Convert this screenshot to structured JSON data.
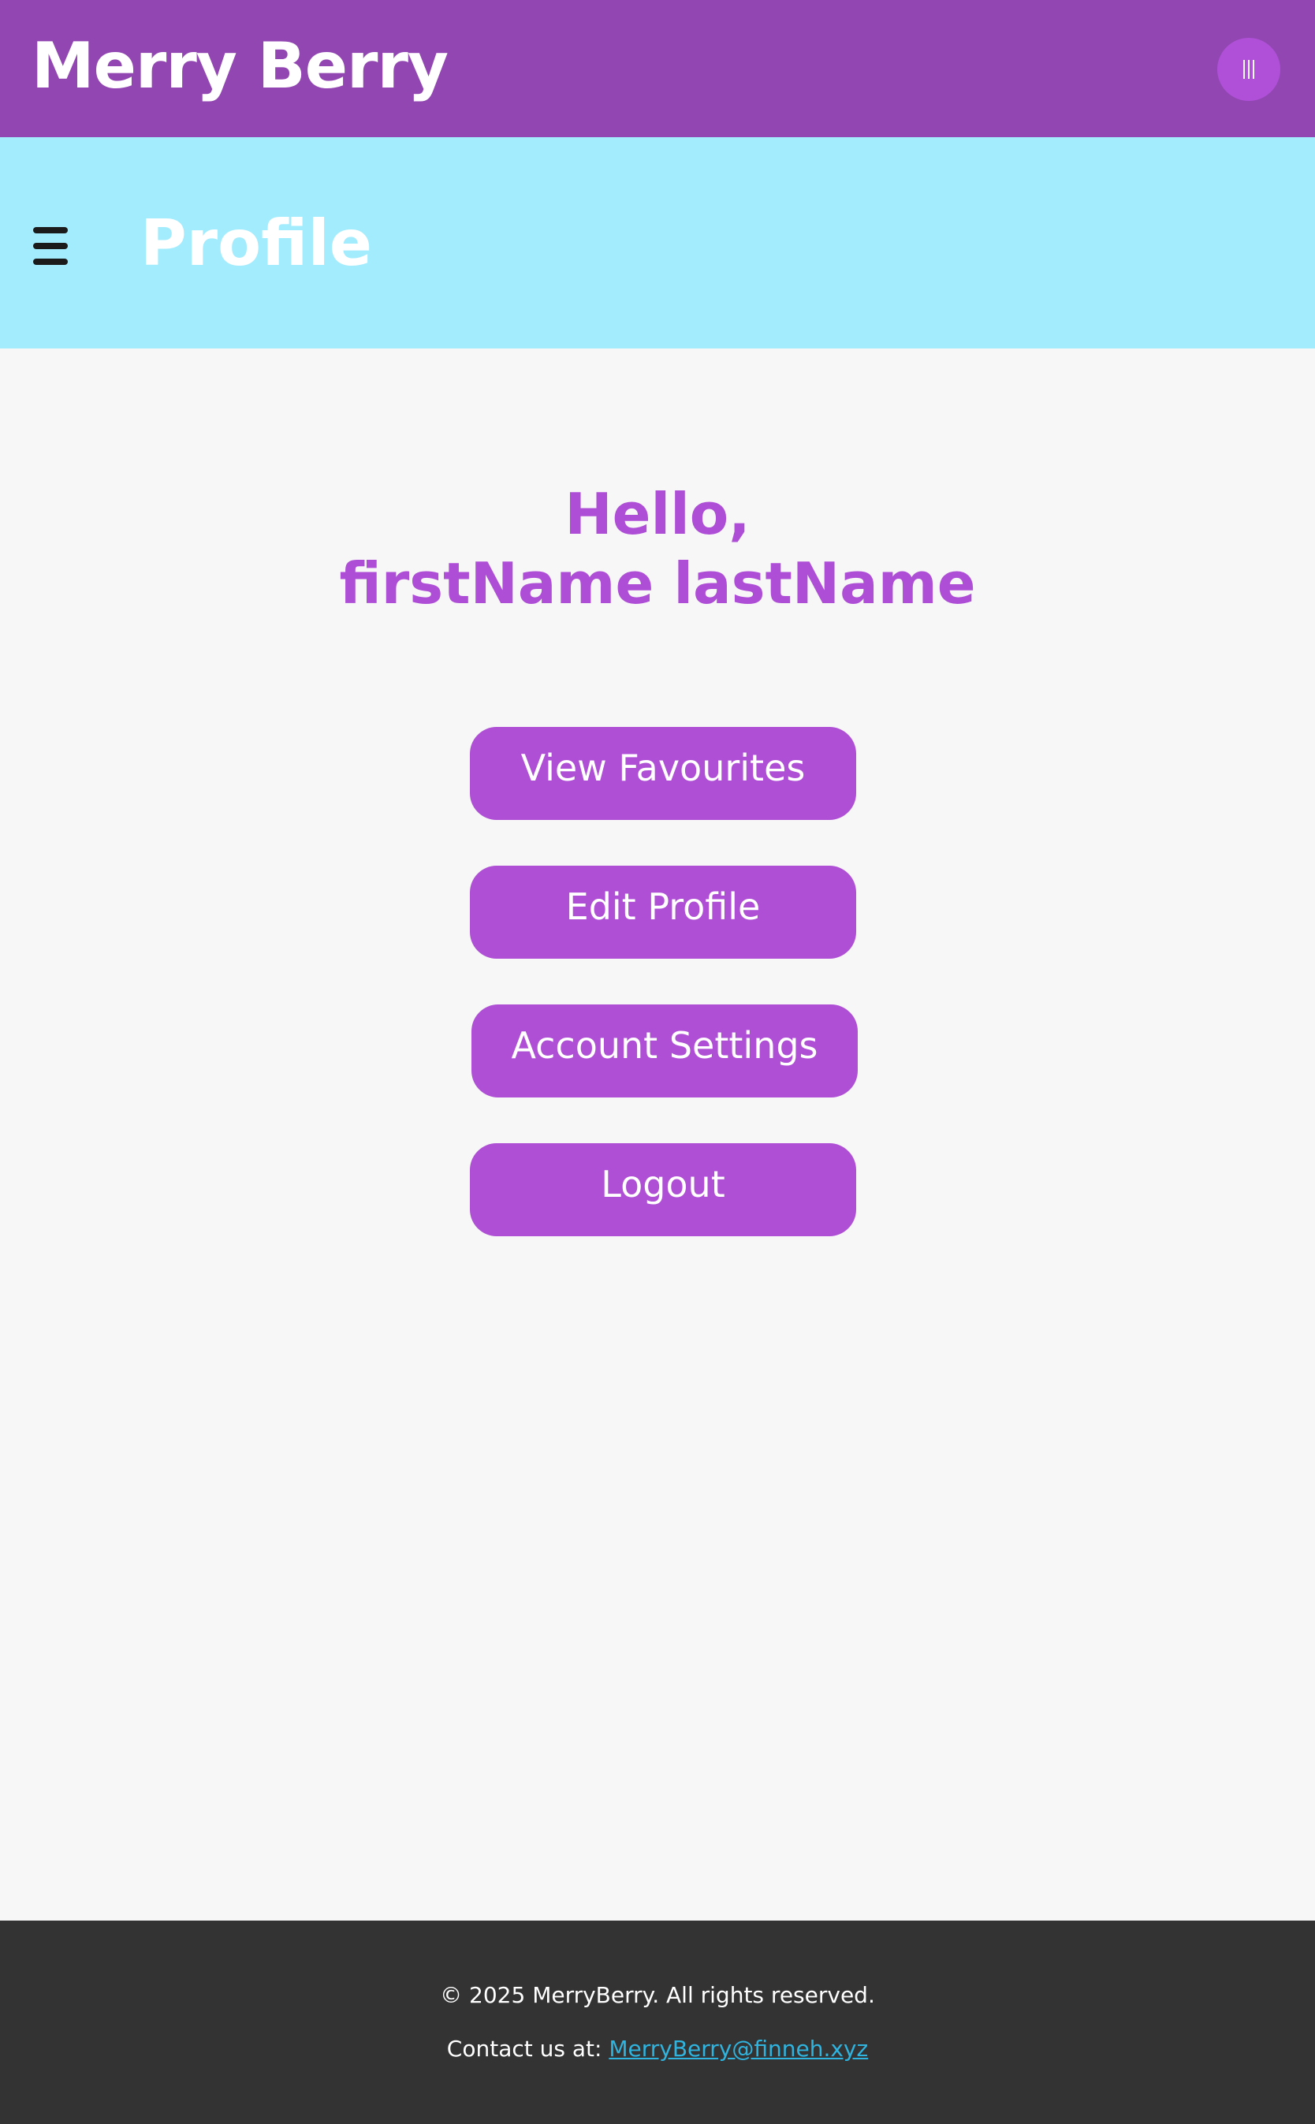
{
  "header": {
    "brand": "Merry Berry",
    "menu_icon": "vertical-bars-icon"
  },
  "subheader": {
    "menu_icon": "hamburger-menu-icon",
    "title": "Profile"
  },
  "greeting": {
    "line1": "Hello,",
    "line2": "firstName lastName"
  },
  "actions": {
    "view_favourites": "View Favourites",
    "edit_profile": "Edit Profile",
    "account_settings": "Account Settings",
    "logout": "Logout"
  },
  "footer": {
    "copyright": "© 2025 MerryBerry. All rights reserved.",
    "contact_label": "Contact us at: ",
    "contact_email": "MerryBerry@finneh.xyz"
  },
  "colors": {
    "topbar": "#9146b1",
    "subheader": "#a3ecfd",
    "accent": "#ae4fd5",
    "footer": "#333333",
    "link": "#2fb4df"
  }
}
